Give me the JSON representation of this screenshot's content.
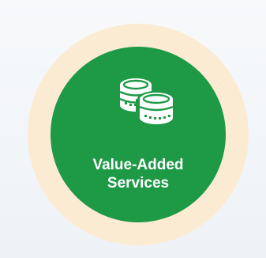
{
  "colors": {
    "background": "#f2f5f8",
    "ring": "#fcebd3",
    "circle": "#1e9a47",
    "text": "#ffffff"
  },
  "icon": {
    "name": "coins-icon"
  },
  "label": {
    "line1": "Value-Added",
    "line2": "Services"
  }
}
